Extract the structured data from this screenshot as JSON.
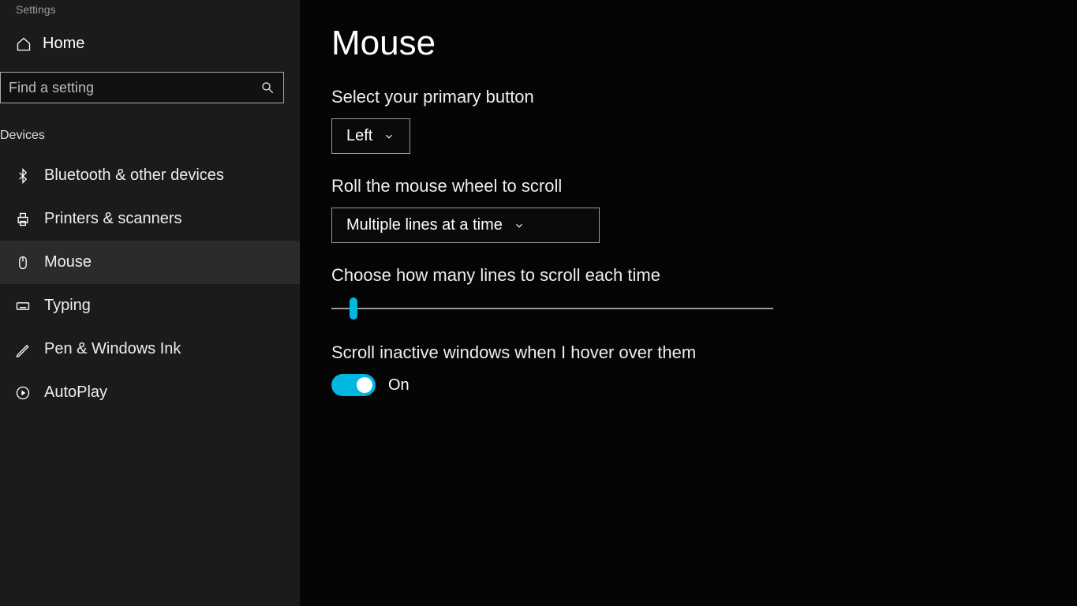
{
  "app_title": "Settings",
  "sidebar": {
    "home_label": "Home",
    "search_placeholder": "Find a setting",
    "category_label": "Devices",
    "items": [
      {
        "icon": "bluetooth",
        "label": "Bluetooth & other devices"
      },
      {
        "icon": "printer",
        "label": "Printers & scanners"
      },
      {
        "icon": "mouse",
        "label": "Mouse"
      },
      {
        "icon": "typing",
        "label": "Typing"
      },
      {
        "icon": "pen",
        "label": "Pen & Windows Ink"
      },
      {
        "icon": "autoplay",
        "label": "AutoPlay"
      }
    ]
  },
  "main": {
    "title": "Mouse",
    "primary_button": {
      "label": "Select your primary button",
      "value": "Left"
    },
    "scroll_mode": {
      "label": "Roll the mouse wheel to scroll",
      "value": "Multiple lines at a time"
    },
    "lines_per_scroll": {
      "label": "Choose how many lines to scroll each time"
    },
    "inactive_scroll": {
      "label": "Scroll inactive windows when I hover over them",
      "state_label": "On"
    }
  },
  "colors": {
    "accent": "#00b7e0"
  }
}
